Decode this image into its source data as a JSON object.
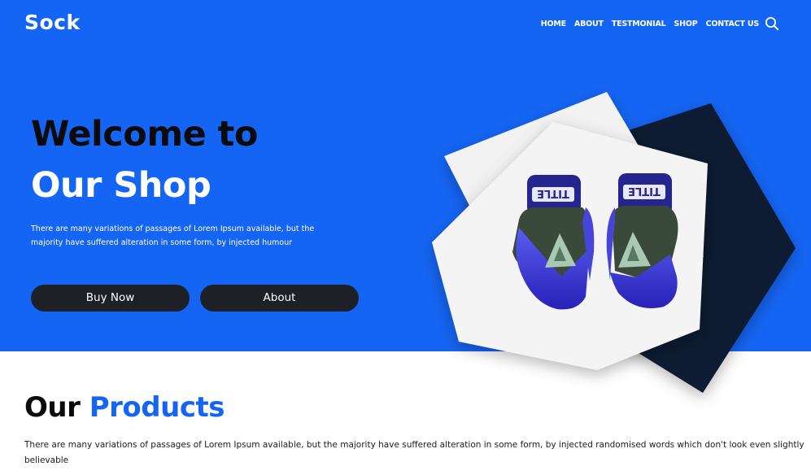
{
  "header": {
    "logo": "Sock",
    "nav": [
      "HOME",
      "ABOUT",
      "TESTMONIAL",
      "SHOP",
      "CONTACT US"
    ]
  },
  "hero": {
    "title_line1": "Welcome to",
    "title_line2": "Our Shop",
    "description": "There are many variations of passages of Lorem Ipsum available, but the majority have suffered alteration in some form, by injected humour",
    "buy_label": "Buy Now",
    "about_label": "About"
  },
  "products": {
    "title_word1": "Our",
    "title_word2": "Products",
    "description": "There are many variations of passages of Lorem Ipsum available, but the majority have suffered alteration in some form, by injected randomised words which don't look even slightly believable"
  },
  "colors": {
    "primary_blue": "#1565f4",
    "dark_button": "#1d2027",
    "navy_square": "#0c1a33"
  },
  "icons": [
    "search-icon",
    "boxing-gloves-image"
  ]
}
